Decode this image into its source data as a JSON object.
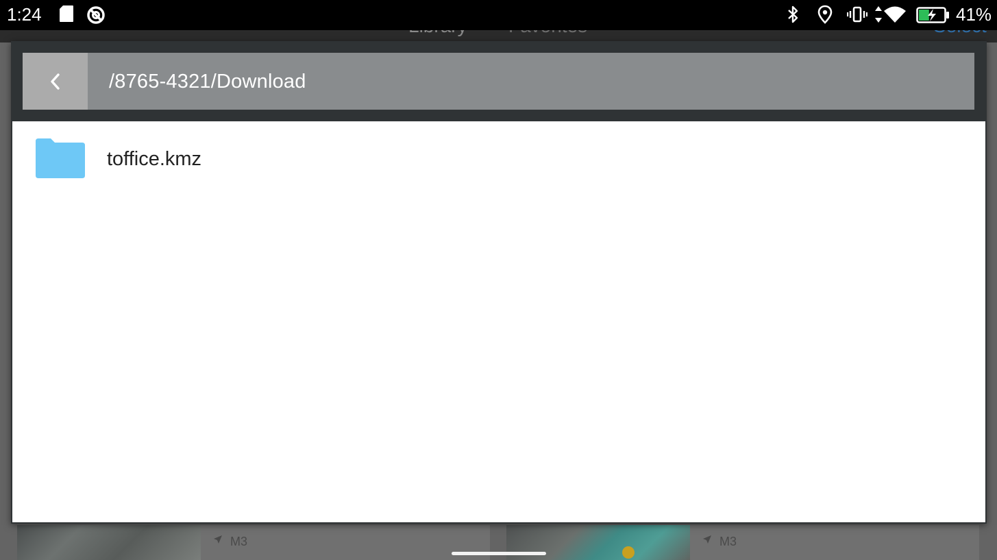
{
  "status_bar": {
    "time": "1:24",
    "battery_percent": "41%",
    "battery_level": 0.41,
    "icons": [
      "sd-card-icon",
      "sync-disabled-icon",
      "bluetooth-icon",
      "location-icon",
      "vibrate-icon",
      "data-arrows-icon",
      "wifi-icon",
      "battery-charging-icon"
    ]
  },
  "background_app": {
    "tabs": [
      "Library",
      "Favorites"
    ],
    "select_label": "Select",
    "cards": [
      {
        "meta": "M3"
      },
      {
        "meta": "M3"
      }
    ]
  },
  "dialog": {
    "path": "/8765-4321/Download",
    "back_icon": "chevron-left-icon",
    "items": [
      {
        "name": "toffice.kmz",
        "icon": "folder-icon",
        "icon_color": "#6ec8f6"
      }
    ]
  },
  "colors": {
    "folder": "#6ec8f6",
    "path_bar": "#898c8e",
    "back_button": "#ababab",
    "select_accent": "#2f6ea8"
  }
}
